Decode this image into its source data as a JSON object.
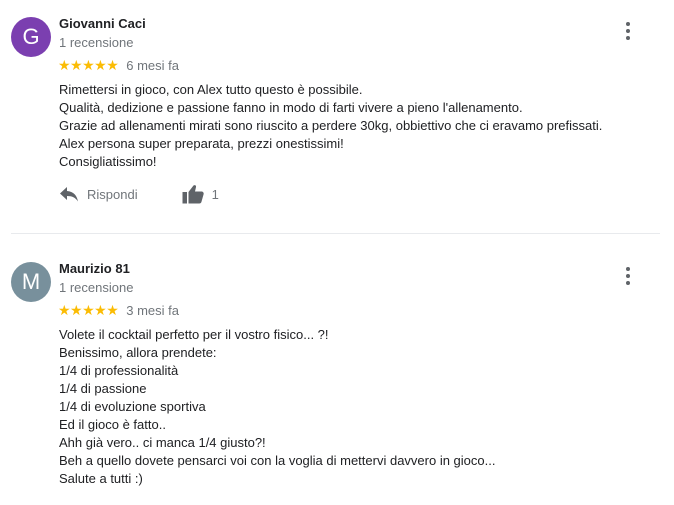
{
  "reviews": [
    {
      "avatar_letter": "G",
      "avatar_color": "#7b3fb0",
      "name": "Giovanni Caci",
      "count": "1 recensione",
      "stars": "★★★★★",
      "when": "6 mesi fa",
      "lines": [
        "Rimettersi in gioco, con Alex tutto questo è possibile.",
        "Qualità, dedizione e passione fanno in modo di farti vivere a pieno l'allenamento.",
        "Grazie ad allenamenti mirati sono riuscito a perdere 30kg, obbiettivo che ci eravamo prefissati.",
        "Alex persona super preparata, prezzi onestissimi!",
        "Consigliatissimo!"
      ],
      "reply_label": "Rispondi",
      "likes": "1"
    },
    {
      "avatar_letter": "M",
      "avatar_color": "#78909c",
      "name": "Maurizio 81",
      "count": "1 recensione",
      "stars": "★★★★★",
      "when": "3 mesi fa",
      "lines": [
        "Volete il cocktail perfetto per il vostro fisico... ?!",
        "Benissimo, allora prendete:",
        "1/4 di professionalità",
        "1/4 di passione",
        "1/4 di evoluzione sportiva",
        "Ed il gioco è fatto..",
        "Ahh già vero.. ci manca 1/4 giusto?!",
        "Beh a quello dovete pensarci voi con la voglia di mettervi davvero in gioco...",
        "Salute a tutti :)"
      ]
    }
  ],
  "icons": {
    "more": "more-vert-icon",
    "reply": "reply-icon",
    "like": "thumb-up-icon"
  }
}
